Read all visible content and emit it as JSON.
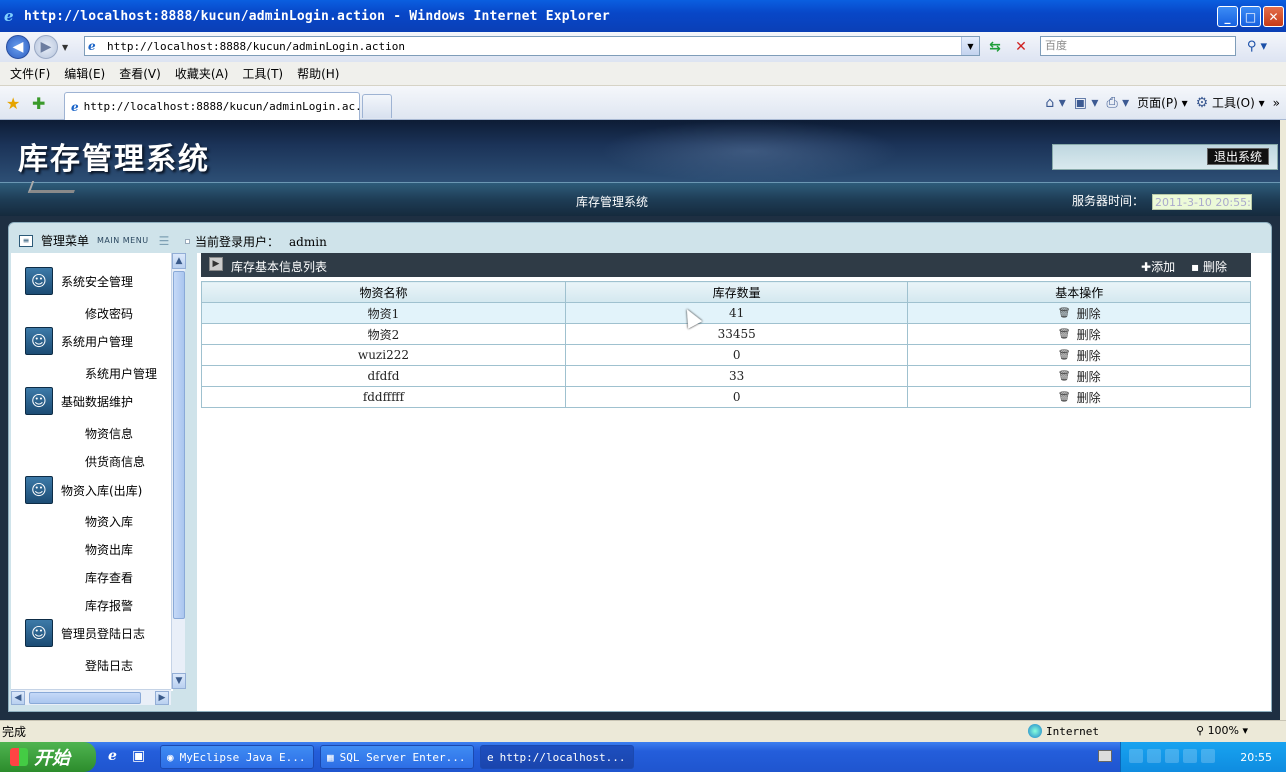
{
  "window": {
    "title": "http://localhost:8888/kucun/adminLogin.action - Windows Internet Explorer"
  },
  "address": {
    "url": "http://localhost:8888/kucun/adminLogin.action",
    "search_placeholder": "百度"
  },
  "menubar": {
    "items": [
      "文件(F)",
      "编辑(E)",
      "查看(V)",
      "收藏夹(A)",
      "工具(T)",
      "帮助(H)"
    ]
  },
  "tab": {
    "title": "http://localhost:8888/kucun/adminLogin.ac..."
  },
  "commandbar": {
    "page_label": "页面(P)",
    "tools_label": "工具(O)"
  },
  "page": {
    "system_title": "库存管理系统",
    "logout_label": "退出系统",
    "subbar_title": "库存管理系统",
    "server_time_label": "服务器时间：",
    "server_time_value": "2011-3-10 20:55:",
    "menu_title_cn": "管理菜单",
    "menu_title_en": "MAIN MENU",
    "user_label": "当前登录用户：",
    "user_name": "admin"
  },
  "leftmenu": {
    "groups": [
      {
        "label": "系统安全管理",
        "subs": [
          "修改密码"
        ]
      },
      {
        "label": "系统用户管理",
        "subs": [
          "系统用户管理"
        ]
      },
      {
        "label": "基础数据维护",
        "subs": [
          "物资信息",
          "供货商信息"
        ]
      },
      {
        "label": "物资入库(出库)",
        "subs": [
          "物资入库",
          "物资出库",
          "库存查看",
          "库存报警"
        ]
      },
      {
        "label": "管理员登陆日志",
        "subs": [
          "登陆日志"
        ]
      }
    ]
  },
  "list": {
    "title": "库存基本信息列表",
    "add_label": "添加",
    "delete_label": "删除",
    "columns": [
      "物资名称",
      "库存数量",
      "基本操作"
    ],
    "row_action": "删除",
    "rows": [
      {
        "name": "物资1",
        "qty": "41"
      },
      {
        "name": "物资2",
        "qty": "33455"
      },
      {
        "name": "wuzi222",
        "qty": "0"
      },
      {
        "name": "dfdfd",
        "qty": "33"
      },
      {
        "name": "fddfffff",
        "qty": "0"
      }
    ]
  },
  "status": {
    "text": "完成",
    "zone": "Internet",
    "zoom": "100%"
  },
  "taskbar": {
    "start_label": "开始",
    "tasks": [
      "MyEclipse Java E...",
      "SQL Server Enter...",
      "http://localhost..."
    ],
    "clock": "20:55"
  }
}
